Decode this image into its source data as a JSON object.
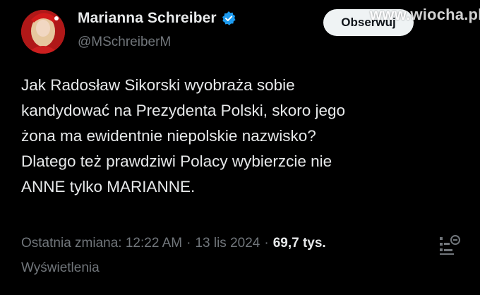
{
  "author": {
    "display_name": "Marianna Schreiber",
    "handle": "@MSchreiberM",
    "verified_color": "#1d9bf0"
  },
  "follow_button": {
    "label": "Obserwuj"
  },
  "watermark": "www.wiocha.pl",
  "tweet": {
    "lines": [
      "Jak Radosław Sikorski wyobraża sobie",
      "kandydować na Prezydenta Polski, skoro jego",
      "żona ma ewidentnie niepolskie nazwisko?",
      "Dlatego też prawdziwi Polacy wybierzcie nie",
      "ANNE tylko MARIANNE."
    ]
  },
  "meta": {
    "edited_label": "Ostatnia zmiana: 12:22 AM",
    "separator": "·",
    "date": "13 lis 2024",
    "views_count": "69,7 tys.",
    "views_label": "Wyświetlenia"
  },
  "icons": {
    "verified": "verified-badge-icon",
    "analytics": "analytics-icon"
  },
  "colors": {
    "background": "#000000",
    "text_primary": "#e7e9ea",
    "text_secondary": "#71767b",
    "accent": "#1d9bf0",
    "button_bg": "#eff3f4"
  }
}
